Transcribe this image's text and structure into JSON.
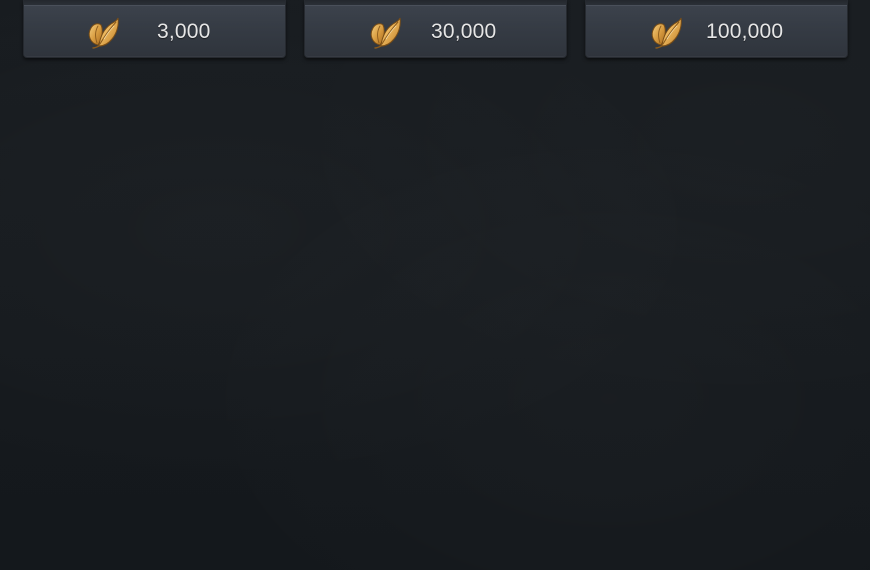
{
  "currency_icon": "gold-leaf-icon",
  "colors": {
    "background": "#15191d",
    "card": "#363c45",
    "text": "#e6e6e6",
    "leaf_gold": "#e2a946"
  },
  "shop": {
    "items": [
      {
        "price": "3,000"
      },
      {
        "price": "30,000"
      },
      {
        "price": "100,000"
      }
    ]
  }
}
